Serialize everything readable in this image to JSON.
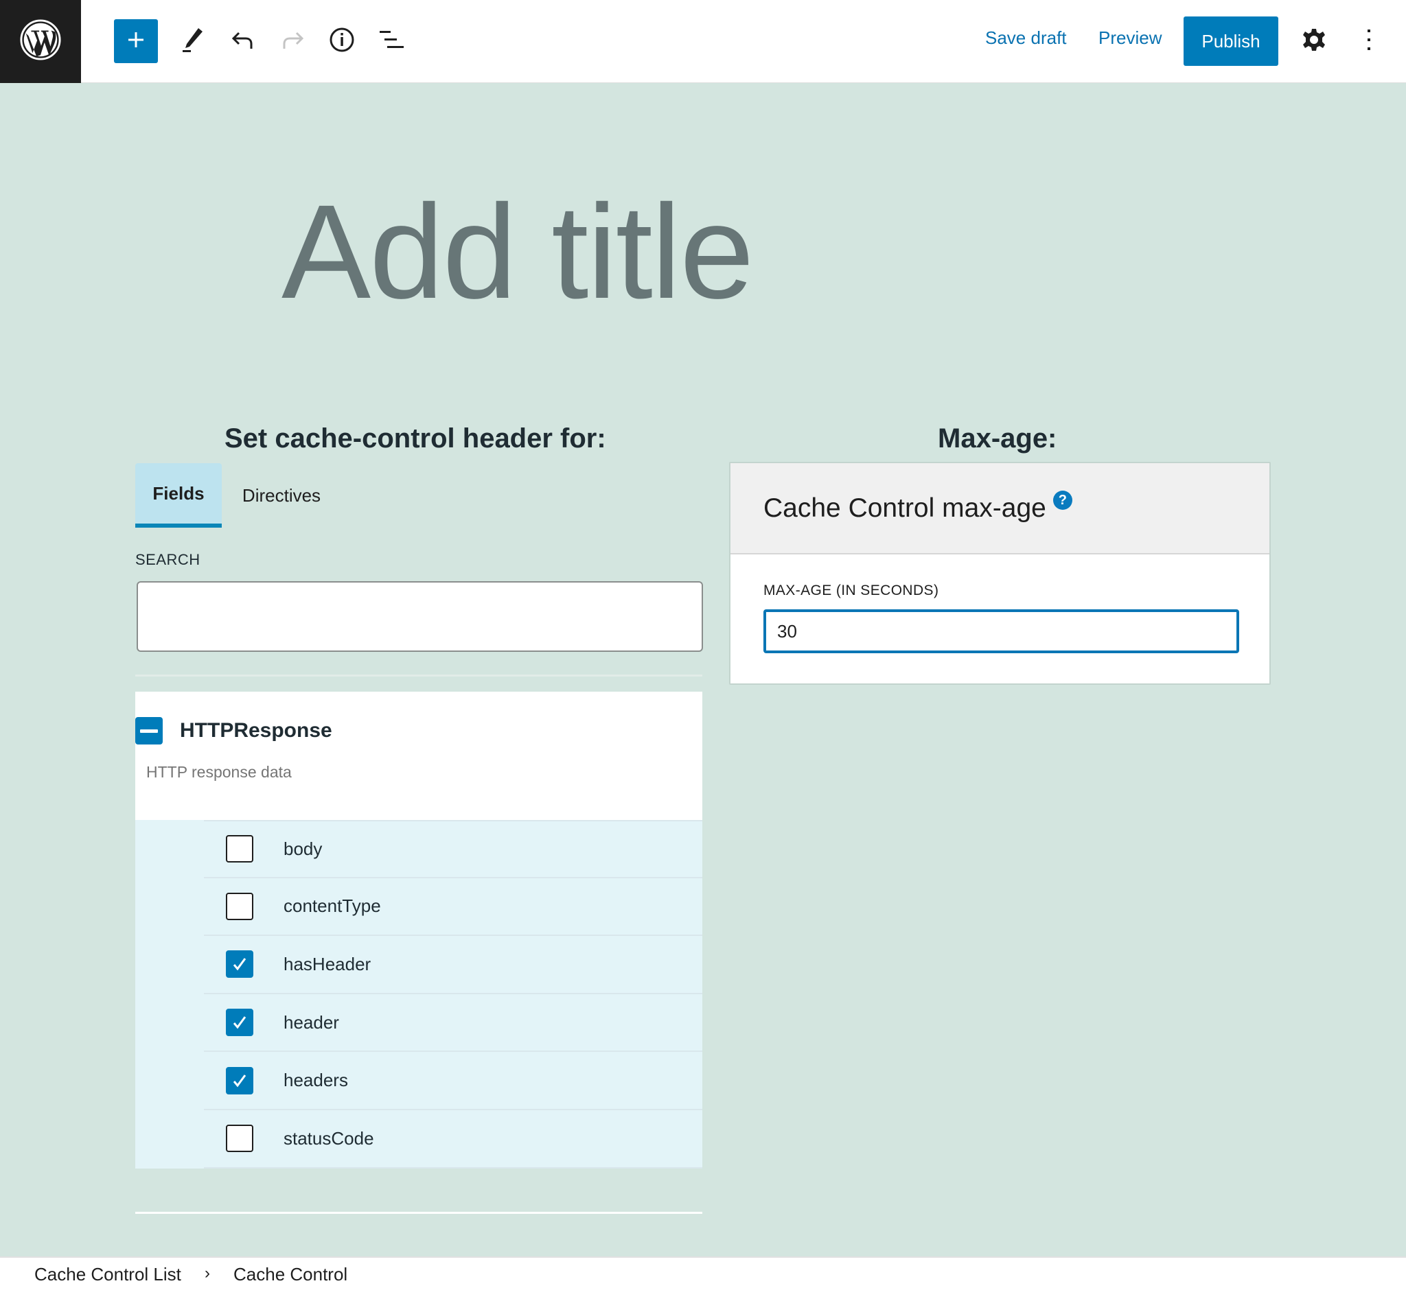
{
  "toolbar": {
    "logo_icon": "wordpress-logo-icon",
    "inserter_icon": "plus-icon",
    "tools_icon": "pencil-icon",
    "undo_icon": "undo-icon",
    "redo_icon": "redo-icon",
    "details_icon": "info-icon",
    "list_view_icon": "list-view-icon",
    "save_draft_label": "Save draft",
    "preview_label": "Preview",
    "publish_label": "Publish",
    "settings_icon": "gear-icon",
    "options_icon": "more-vertical-icon"
  },
  "editor": {
    "title_placeholder": "Add title"
  },
  "left": {
    "heading": "Set cache-control header for:",
    "tabs": [
      {
        "label": "Fields",
        "active": true
      },
      {
        "label": "Directives",
        "active": false
      }
    ],
    "search_label": "SEARCH",
    "search_value": "",
    "group": {
      "title": "HTTPResponse",
      "description": "HTTP response data",
      "expanded": true
    },
    "fields": [
      {
        "label": "body",
        "checked": false
      },
      {
        "label": "contentType",
        "checked": false
      },
      {
        "label": "hasHeader",
        "checked": true
      },
      {
        "label": "header",
        "checked": true
      },
      {
        "label": "headers",
        "checked": true
      },
      {
        "label": "statusCode",
        "checked": false
      }
    ]
  },
  "right": {
    "heading": "Max-age:",
    "panel_title": "Cache Control max-age",
    "help_glyph": "?",
    "input_label": "MAX-AGE (IN SECONDS)",
    "input_value": "30"
  },
  "breadcrumb": {
    "items": [
      "Cache Control List",
      "Cache Control"
    ],
    "separator": "›"
  },
  "colors": {
    "accent": "#007cba",
    "canvas": "#d3e5df",
    "active_tab": "#bde3ef",
    "field_list_bg": "#e3f4f8"
  }
}
